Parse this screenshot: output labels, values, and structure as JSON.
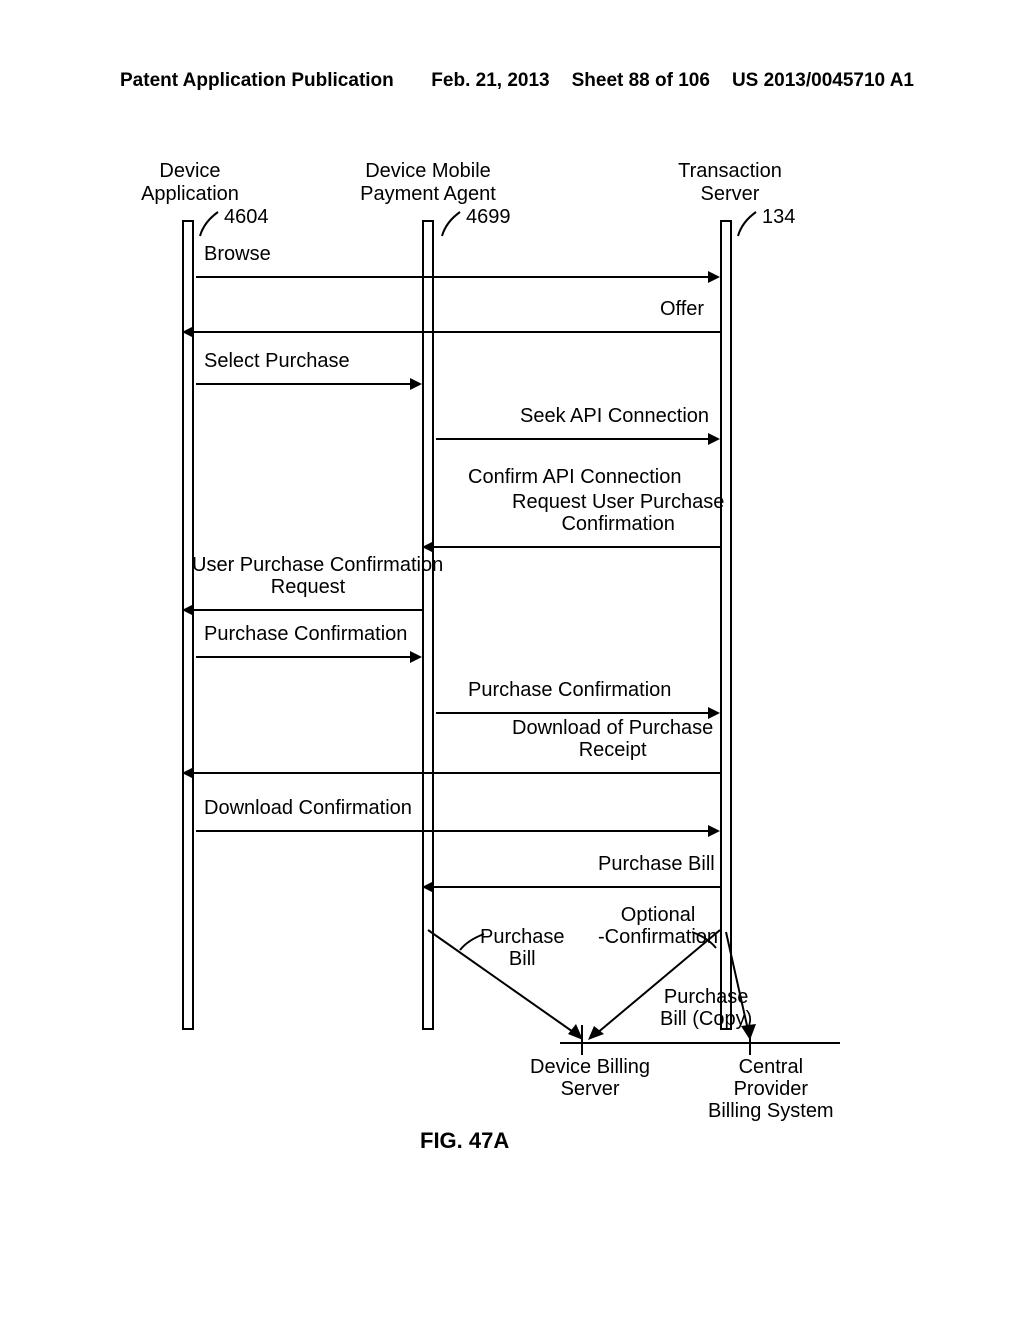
{
  "header": {
    "title": "Patent Application Publication",
    "date": "Feb. 21, 2013",
    "sheet": "Sheet 88 of 106",
    "pubno": "US 2013/0045710 A1"
  },
  "lifelines": {
    "app": "Device\nApplication",
    "agent": "Device Mobile\nPayment Agent",
    "server": "Transaction\nServer"
  },
  "refs": {
    "r4604": "4604",
    "r4699": "4699",
    "r134": "134"
  },
  "messages": {
    "browse": "Browse",
    "offer": "Offer",
    "selectPurchase": "Select Purchase",
    "seekApi": "Seek API Connection",
    "confirmApi": "Confirm API Connection",
    "reqUserConf": "Request User Purchase\nConfirmation",
    "userConfReq": "User Purchase Confirmation\nRequest",
    "purchConf": "Purchase Confirmation",
    "purchConf2": "Purchase Confirmation",
    "dlReceipt": "Download of Purchase\nReceipt",
    "dlConf": "Download Confirmation",
    "purchBill": "Purchase Bill",
    "optConfirm": "Optional\n-Confirmation",
    "purchBill2": "Purchase\nBill",
    "purchBillCopy": "Purchase\nBill (Copy)"
  },
  "nodes": {
    "dbs": "Device Billing\nServer",
    "cpbs": "Central\nProvider\nBilling System"
  },
  "figure": "FIG. 47A"
}
